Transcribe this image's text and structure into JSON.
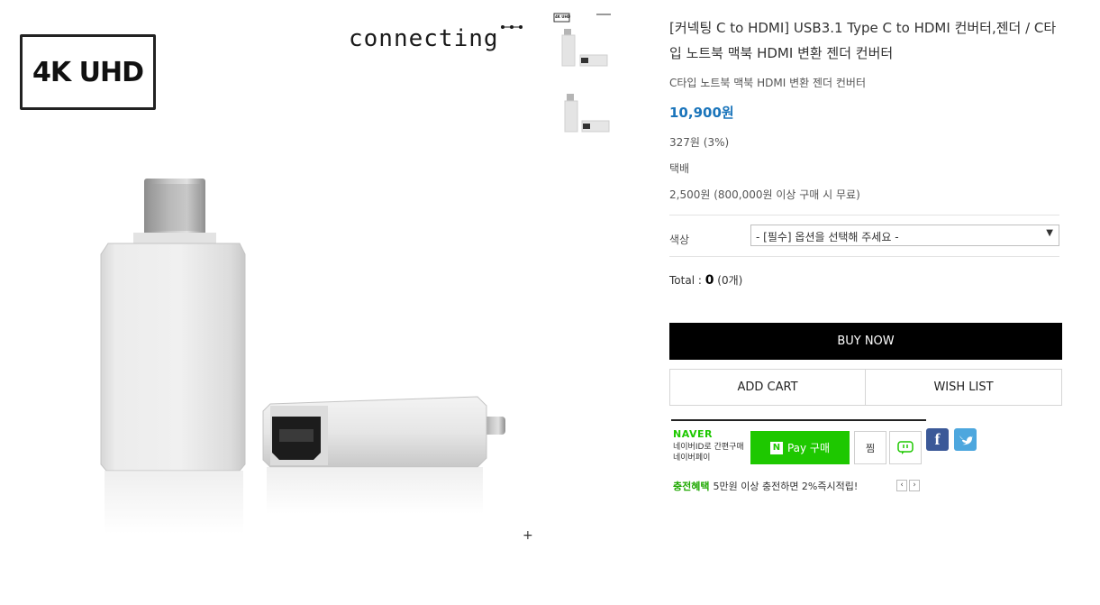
{
  "main_image": {
    "badge_text": "4K UHD",
    "brand_text": "connecting",
    "zoom_icon": "plus-icon",
    "zoom_glyph": "+"
  },
  "thumbnails": [
    {
      "badge_text": "4K UHD"
    },
    {
      "badge_text": ""
    }
  ],
  "product": {
    "title": "[커넥팅 C to HDMI] USB3.1 Type C to HDMI 컨버터,젠더 / C타입 노트북 맥북 HDMI 변환 젠더 컨버터",
    "subtitle": "C타입 노트북 맥북 HDMI 변환 젠더 컨버터",
    "price": "10,900원",
    "points": "327원 (3%)",
    "shipping_method": "택배",
    "shipping_fee": "2,500원 (800,000원 이상 구매 시 무료)",
    "price_color": "#1b75bb"
  },
  "options": {
    "label": "색상",
    "selected": "- [필수] 옵션을 선택해 주세요 -",
    "arrow_glyph": "▼"
  },
  "total": {
    "label": "Total : ",
    "amount": "0",
    "count": "(0개)"
  },
  "actions": {
    "buy_now": "BUY NOW",
    "add_cart": "ADD CART",
    "wish_list": "WISH LIST"
  },
  "naver_pay": {
    "logo": "NAVER",
    "desc": "네이버ID로 간편구매 네이버페이",
    "buy_label": "Pay 구매",
    "n_glyph": "N",
    "zzim_label": "찜",
    "talk_icon": "talk-bubble-icon",
    "brand_color": "#1ec800"
  },
  "social": {
    "facebook_glyph": "f",
    "twitter_icon": "twitter-bird-icon"
  },
  "promo": {
    "highlight": "충전혜택",
    "text": "5만원 이상 충전하면 2%즉시적립!",
    "prev_glyph": "‹",
    "next_glyph": "›"
  }
}
